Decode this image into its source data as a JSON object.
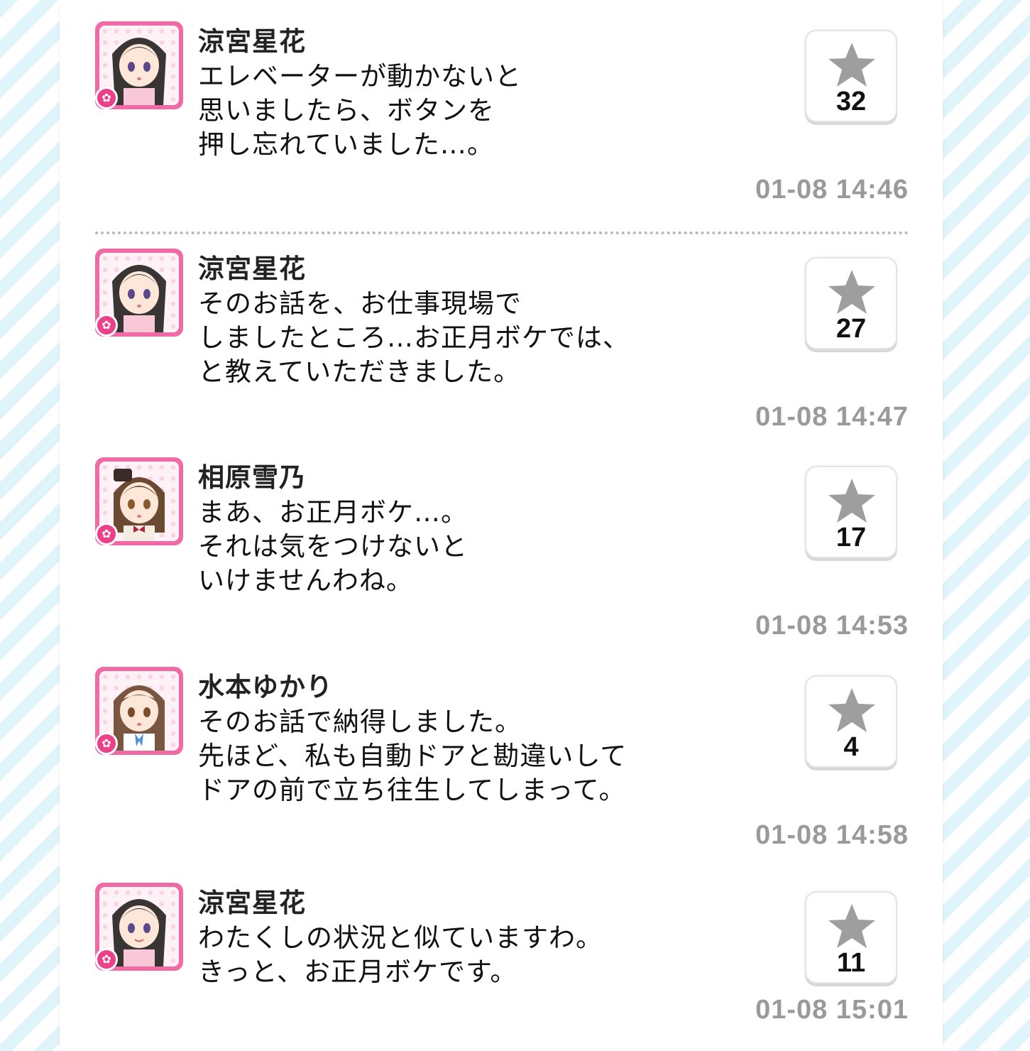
{
  "posts": [
    {
      "name": "涼宮星花",
      "lines": "エレベーターが動かないと\n思いましたら、ボタンを\n押し忘れていました…。",
      "likes": "32",
      "time": "01-08 14:46",
      "avatar": "hoshika-avatar"
    },
    {
      "name": "涼宮星花",
      "lines": "そのお話を、お仕事現場で\nしましたところ…お正月ボケでは、\nと教えていただきました。",
      "likes": "27",
      "time": "01-08 14:47",
      "avatar": "hoshika-avatar"
    },
    {
      "name": "相原雪乃",
      "lines": "まあ、お正月ボケ…。\nそれは気をつけないと\nいけませんわね。",
      "likes": "17",
      "time": "01-08 14:53",
      "avatar": "yukino-avatar"
    },
    {
      "name": "水本ゆかり",
      "lines": "そのお話で納得しました。\n先ほど、私も自動ドアと勘違いして\nドアの前で立ち往生してしまって。",
      "likes": "4",
      "time": "01-08 14:58",
      "avatar": "yukari-avatar"
    },
    {
      "name": "涼宮星花",
      "lines": "わたくしの状況と似ていますわ。\nきっと、お正月ボケです。",
      "likes": "11",
      "time": "01-08 15:01",
      "avatar": "hoshika-avatar"
    }
  ],
  "icons": {
    "like": "star-icon",
    "badge": "flower-icon"
  },
  "colors": {
    "avatar_frame": "#f06aa6",
    "badge": "#ee3f8a",
    "star": "#9e9e9e",
    "timestamp": "#9a9a9a",
    "stripe": "#dff5fb"
  }
}
